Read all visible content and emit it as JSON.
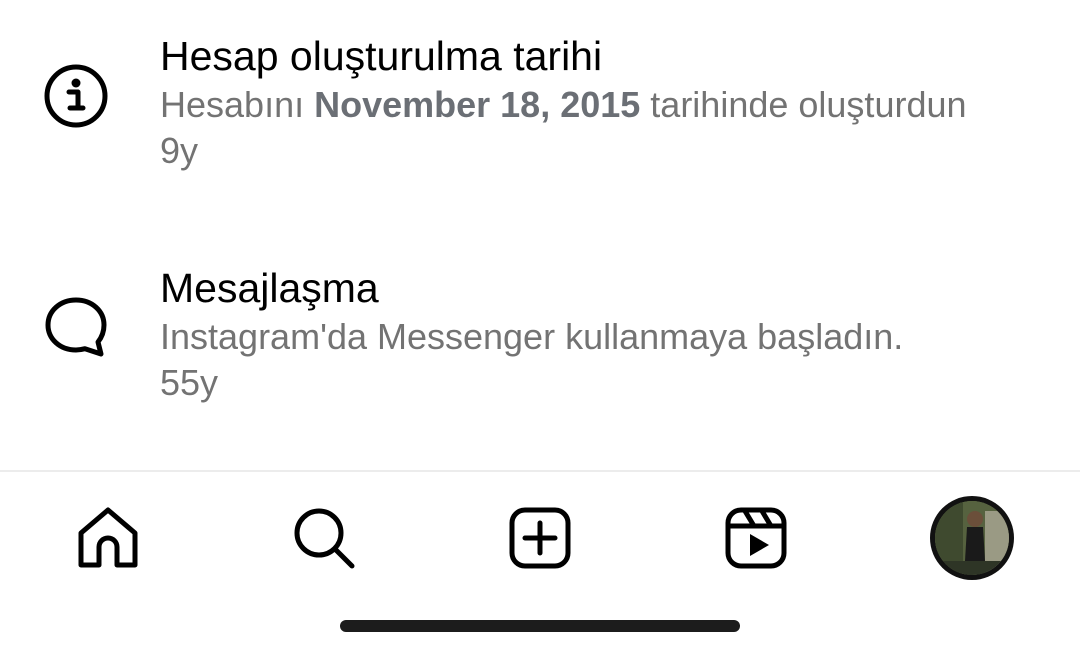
{
  "activity": {
    "items": [
      {
        "icon": "info-icon",
        "title": "Hesap oluşturulma tarihi",
        "desc_prefix": "Hesabını ",
        "desc_bold": "November 18, 2015",
        "desc_suffix": " tarihinde oluşturdun",
        "time": "9y"
      },
      {
        "icon": "message-bubble-icon",
        "title": "Mesajlaşma",
        "desc": "Instagram'da Messenger kullanmaya başladın.",
        "time": "55y"
      }
    ]
  },
  "tabbar": {
    "tabs": [
      {
        "icon": "home-icon"
      },
      {
        "icon": "search-icon"
      },
      {
        "icon": "create-icon"
      },
      {
        "icon": "reels-icon"
      },
      {
        "icon": "profile-avatar"
      }
    ]
  },
  "colors": {
    "primary_text": "#000000",
    "secondary_text": "#737373",
    "divider": "#ececec",
    "home_indicator": "#1c1c1c"
  }
}
